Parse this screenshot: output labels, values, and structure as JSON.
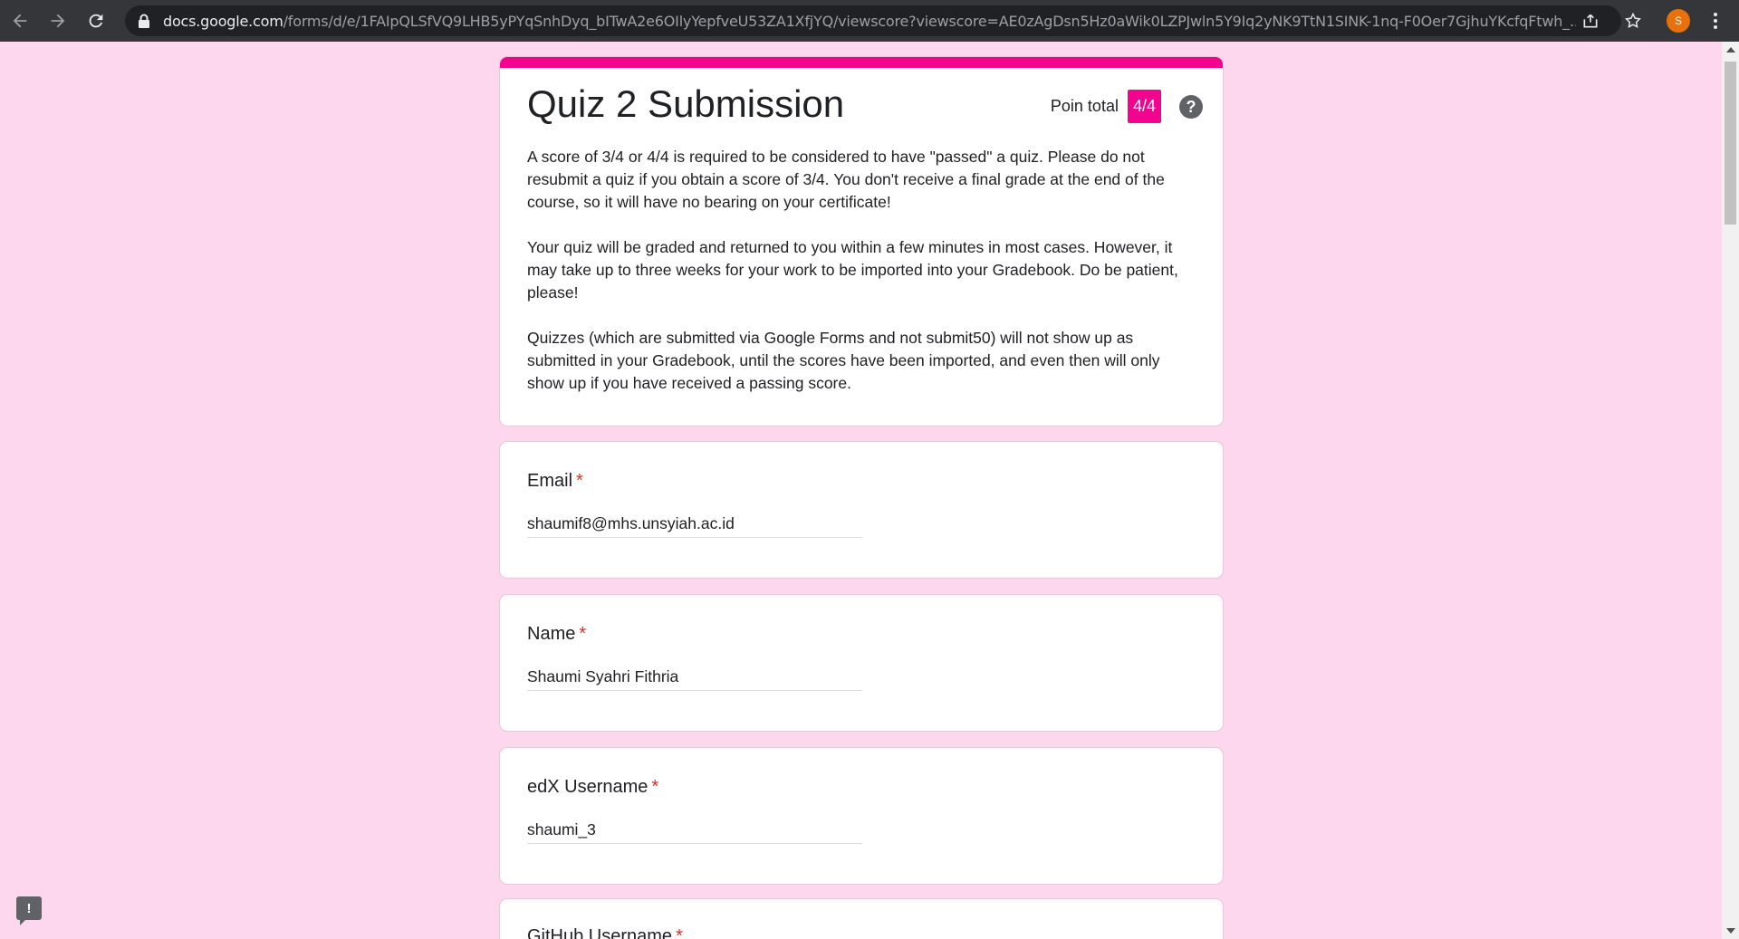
{
  "browser": {
    "url_host": "docs.google.com",
    "url_path": "/forms/d/e/1FAIpQLSfVQ9LHB5yPYqSnhDyq_bITwA2e6OIlyYepfveU53ZA1XfjYQ/viewscore?viewscore=AE0zAgDsn5Hz0aWik0LZPJwln5Y9Iq2yNK9TtN1SINK-1nq-F0Oer7GjhuYKcfqFtwh_...",
    "profile_initial": "S",
    "accent_color": "#e8710a"
  },
  "form": {
    "title": "Quiz 2 Submission",
    "points_label": "Poin total",
    "points_value": "4/4",
    "help_symbol": "?",
    "description": [
      "A score of 3/4 or 4/4 is required to be considered to have \"passed\" a quiz. Please do not resubmit a quiz if you obtain a score of 3/4. You don't receive a final grade at the end of the course, so it will have no bearing on your certificate!",
      "Your quiz will be graded and returned to you within a few minutes in most cases. However, it may take up to three weeks for your work to be imported into your Gradebook. Do be patient, please!",
      "Quizzes (which are submitted via Google Forms and not submit50) will not show up as submitted in your Gradebook, until the scores have been imported, and even then will only show up if you have received a passing score."
    ],
    "required_mark": "*",
    "questions": [
      {
        "label": "Email",
        "answer": "shaumif8@mhs.unsyiah.ac.id"
      },
      {
        "label": "Name",
        "answer": "Shaumi Syahri Fithria"
      },
      {
        "label": "edX Username",
        "answer": "shaumi_3"
      },
      {
        "label": "GitHub Username",
        "answer": ""
      }
    ],
    "theme_color": "#f3048e",
    "background_color": "#fcd7ee"
  },
  "feedback": {
    "symbol": "!"
  }
}
